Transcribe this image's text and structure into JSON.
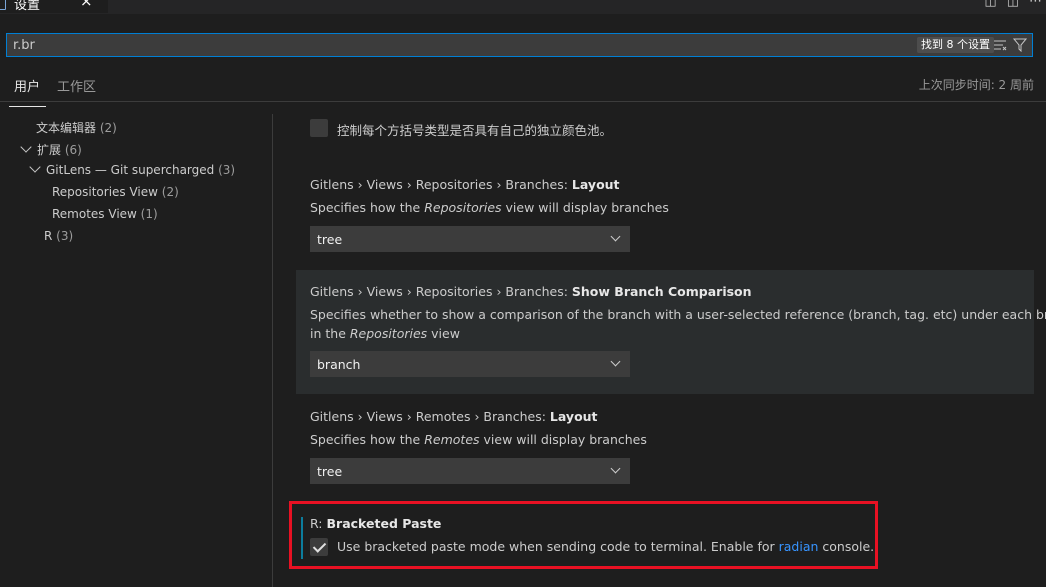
{
  "tab": {
    "title": "设置",
    "close": "×",
    "icon": "file-icon"
  },
  "tab_actions": [
    "split-editor-icon",
    "layout-icon",
    "more-icon"
  ],
  "search": {
    "value": "r.br",
    "placeholder": "",
    "result_count": "找到 8 个设置"
  },
  "scope": {
    "user": "用户",
    "workspace": "工作区",
    "last_sync": "上次同步时间: 2 周前"
  },
  "toc": [
    {
      "label": "文本编辑器",
      "count": "(2)"
    },
    {
      "label": "扩展",
      "count": "(6)",
      "expanded": true
    },
    {
      "label": "GitLens — Git supercharged",
      "count": "(3)",
      "expanded": true
    },
    {
      "label": "Repositories View",
      "count": "(2)"
    },
    {
      "label": "Remotes View",
      "count": "(1)"
    },
    {
      "label": "R",
      "count": "(3)"
    }
  ],
  "settings": {
    "bracket_pair": {
      "label": "控制每个方括号类型是否具有自己的独立颜色池。",
      "checked": false
    },
    "repo_branches_layout": {
      "breadcrumb": "Gitlens › Views › Repositories › Branches: ",
      "name": "Layout",
      "desc_before": "Specifies how the ",
      "desc_em": "Repositories",
      "desc_after": " view will display branches",
      "value": "tree"
    },
    "repo_branch_comparison": {
      "breadcrumb": "Gitlens › Views › Repositories › Branches: ",
      "name": "Show Branch Comparison",
      "desc_line1": "Specifies whether to show a comparison of the branch with a user-selected reference (branch, tag. etc) under each branch",
      "desc_line2_before": "in the ",
      "desc_line2_em": "Repositories",
      "desc_line2_after": " view",
      "value": "branch"
    },
    "remotes_branches_layout": {
      "breadcrumb": "Gitlens › Views › Remotes › Branches: ",
      "name": "Layout",
      "desc_before": "Specifies how the ",
      "desc_em": "Remotes",
      "desc_after": " view will display branches",
      "value": "tree"
    },
    "r_bracketed_paste": {
      "breadcrumb": "R: ",
      "name": "Bracketed Paste",
      "desc_before": "Use bracketed paste mode when sending code to terminal. Enable for ",
      "link": "radian",
      "desc_after": " console.",
      "checked": true
    }
  },
  "colors": {
    "accent": "#007fd4",
    "link": "#3794ff",
    "highlight": "#e81123",
    "modified": "#0c7d9d"
  }
}
